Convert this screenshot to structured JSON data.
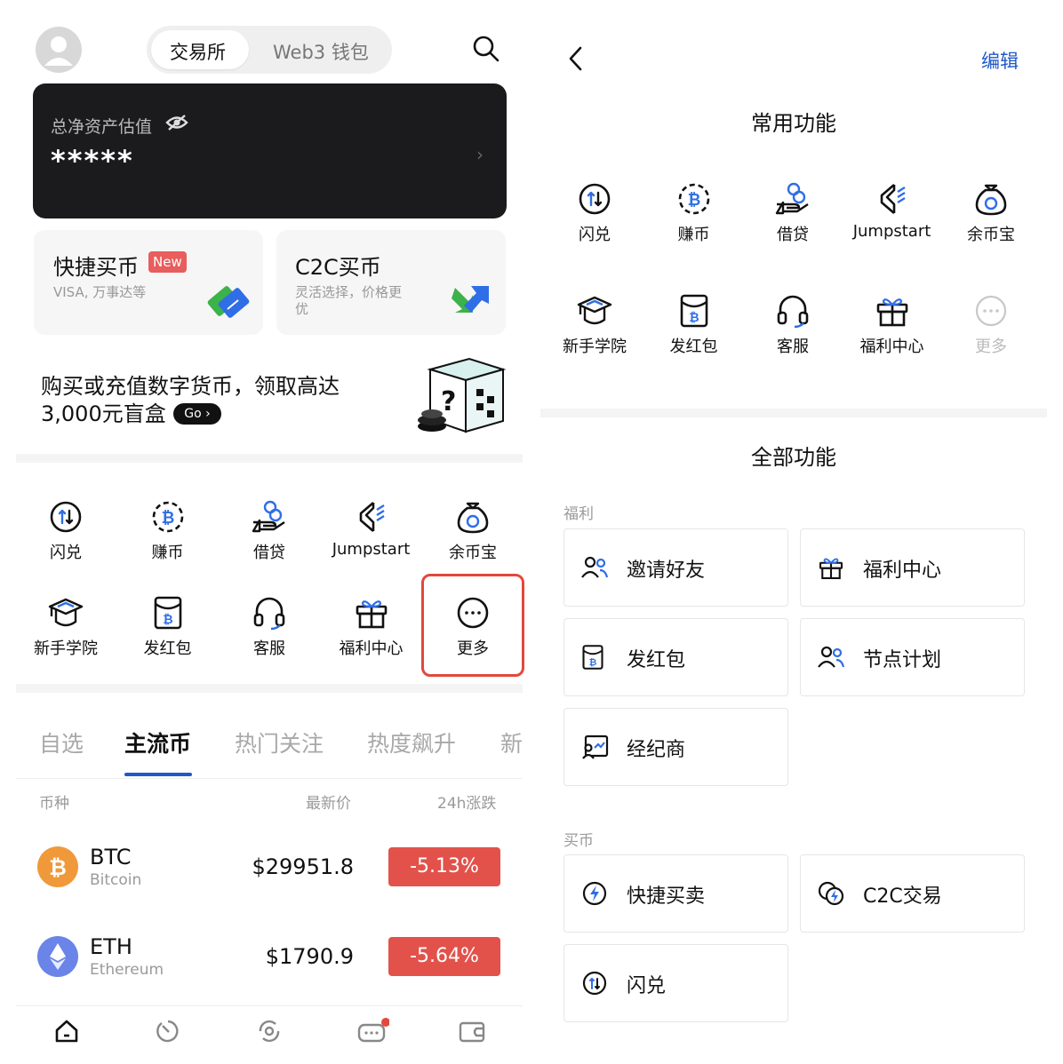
{
  "left": {
    "header": {
      "segment_tabs": [
        "交易所",
        "Web3 钱包"
      ]
    },
    "asset_card": {
      "label": "总净资产估值",
      "value": "*****",
      "chevron": "›"
    },
    "buy_cards": [
      {
        "title": "快捷买币",
        "badge": "New",
        "subtitle": "VISA, 万事达等"
      },
      {
        "title": "C2C买币",
        "subtitle_line1": "灵活选择，价格更",
        "subtitle_line2": "优"
      }
    ],
    "promo": {
      "line1": "购买或充值数字货币，领取高达",
      "line2": "3,000元盲盒",
      "go": "Go ›"
    },
    "features": [
      {
        "label": "闪兑",
        "icon": "swap-icon"
      },
      {
        "label": "赚币",
        "icon": "earn-icon"
      },
      {
        "label": "借贷",
        "icon": "loan-icon"
      },
      {
        "label": "Jumpstart",
        "icon": "jumpstart-icon"
      },
      {
        "label": "余币宝",
        "icon": "savings-icon"
      },
      {
        "label": "新手学院",
        "icon": "academy-icon"
      },
      {
        "label": "发红包",
        "icon": "red-packet-icon"
      },
      {
        "label": "客服",
        "icon": "headset-icon"
      },
      {
        "label": "福利中心",
        "icon": "gift-icon"
      },
      {
        "label": "更多",
        "icon": "more-icon"
      }
    ],
    "market_tabs": [
      "自选",
      "主流币",
      "热门关注",
      "热度飙升",
      "新"
    ],
    "columns": {
      "coin": "币种",
      "price": "最新价",
      "change": "24h涨跌"
    },
    "coins": [
      {
        "symbol": "BTC",
        "name": "Bitcoin",
        "price": "$29951.8",
        "change": "-5.13%",
        "color": "#f0993b"
      },
      {
        "symbol": "ETH",
        "name": "Ethereum",
        "price": "$1790.9",
        "change": "-5.64%",
        "color": "#6a84e8"
      }
    ],
    "bottom_nav": [
      "home-icon",
      "markets-icon",
      "trade-icon",
      "chat-icon",
      "wallet-icon"
    ]
  },
  "right": {
    "edit": "编辑",
    "common_title": "常用功能",
    "common": [
      {
        "label": "闪兑"
      },
      {
        "label": "赚币"
      },
      {
        "label": "借贷"
      },
      {
        "label": "Jumpstart"
      },
      {
        "label": "余币宝"
      },
      {
        "label": "新手学院"
      },
      {
        "label": "发红包"
      },
      {
        "label": "客服"
      },
      {
        "label": "福利中心"
      },
      {
        "label": "更多"
      }
    ],
    "all_title": "全部功能",
    "welfare_label": "福利",
    "welfare": [
      {
        "label": "邀请好友"
      },
      {
        "label": "福利中心"
      },
      {
        "label": "发红包"
      },
      {
        "label": "节点计划"
      },
      {
        "label": "经纪商"
      }
    ],
    "buy_label": "买币",
    "buy": [
      {
        "label": "快捷买卖"
      },
      {
        "label": "C2C交易"
      },
      {
        "label": "闪兑"
      }
    ]
  },
  "colors": {
    "accent": "#1f58c9",
    "down": "#e2524b",
    "highlight": "#e2483d"
  }
}
